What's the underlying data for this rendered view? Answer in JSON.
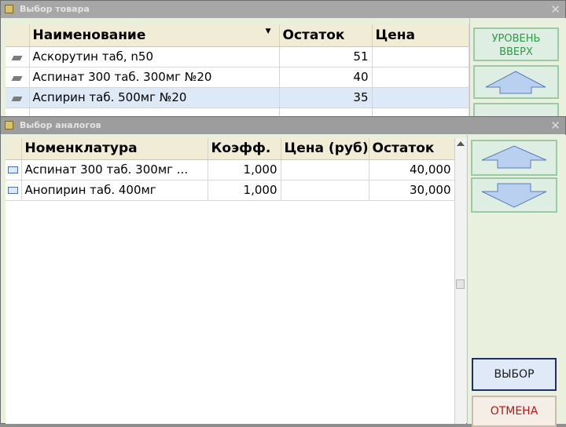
{
  "win1": {
    "title": "Выбор товара",
    "close": "✕",
    "columns": {
      "name": "Наименование",
      "stock": "Остаток",
      "price": "Цена"
    },
    "rows": [
      {
        "name": "Аскорутин таб, n50",
        "stock": "51",
        "price": ""
      },
      {
        "name": "Аспинат 300 таб. 300мг №20",
        "stock": "40",
        "price": ""
      },
      {
        "name": "Аспирин таб. 500мг №20",
        "stock": "35",
        "price": ""
      }
    ],
    "level_up": {
      "line1": "УРОВЕНЬ",
      "line2": "ВВЕРХ"
    }
  },
  "win2": {
    "title": "Выбор аналогов",
    "close": "✕",
    "columns": {
      "nomenclature": "Номенклатура",
      "coef": "Коэфф.",
      "price": "Цена (руб)",
      "stock": "Остаток"
    },
    "rows": [
      {
        "name": "Аспинат 300 таб. 300мг ...",
        "coef": "1,000",
        "price": "",
        "stock": "40,000"
      },
      {
        "name": "Анопирин таб. 400мг",
        "coef": "1,000",
        "price": "",
        "stock": "30,000"
      }
    ],
    "select_label": "ВЫБОР",
    "cancel_label": "ОТМЕНА"
  },
  "colors": {
    "accent_green": "#2e9a47",
    "cancel_red": "#b01a1a",
    "selected_row": "#dde9f7"
  }
}
